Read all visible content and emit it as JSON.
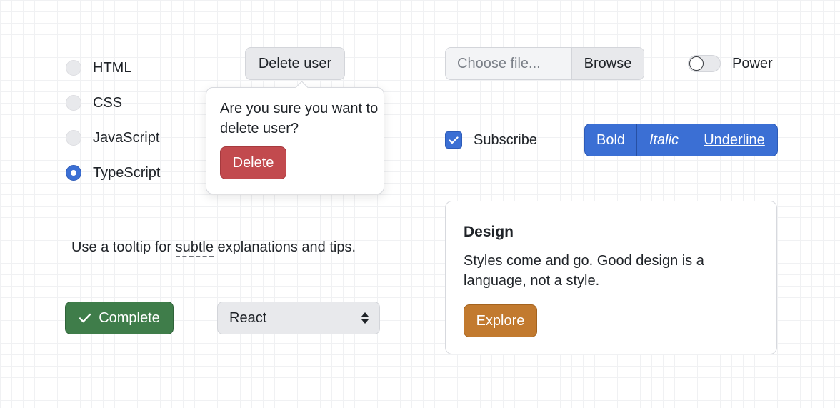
{
  "radio_group": {
    "options": [
      {
        "label": "HTML",
        "checked": false
      },
      {
        "label": "CSS",
        "checked": false
      },
      {
        "label": "JavaScript",
        "checked": false
      },
      {
        "label": "TypeScript",
        "checked": true
      }
    ]
  },
  "delete_popover": {
    "trigger_label": "Delete user",
    "message": "Are you sure you want to delete user?",
    "confirm_label": "Delete"
  },
  "tooltip_sentence": {
    "before": "Use a tooltip for ",
    "trigger": "subtle",
    "after": " explanations and tips."
  },
  "complete_button": {
    "label": "Complete",
    "icon": "check-icon"
  },
  "framework_select": {
    "value": "React",
    "icon": "select-arrows-icon"
  },
  "file_input": {
    "placeholder": "Choose file...",
    "browse_label": "Browse"
  },
  "power_toggle": {
    "label": "Power",
    "on": false
  },
  "subscribe_checkbox": {
    "label": "Subscribe",
    "checked": true
  },
  "format_group": {
    "bold": "Bold",
    "italic": "Italic",
    "underline": "Underline"
  },
  "design_card": {
    "title": "Design",
    "body": "Styles come and go. Good design is a language, not a style.",
    "button_label": "Explore"
  },
  "colors": {
    "primary": "#3b6fd4",
    "danger": "#c24a4e",
    "success": "#3f7d4a",
    "warning": "#c27a2f"
  }
}
